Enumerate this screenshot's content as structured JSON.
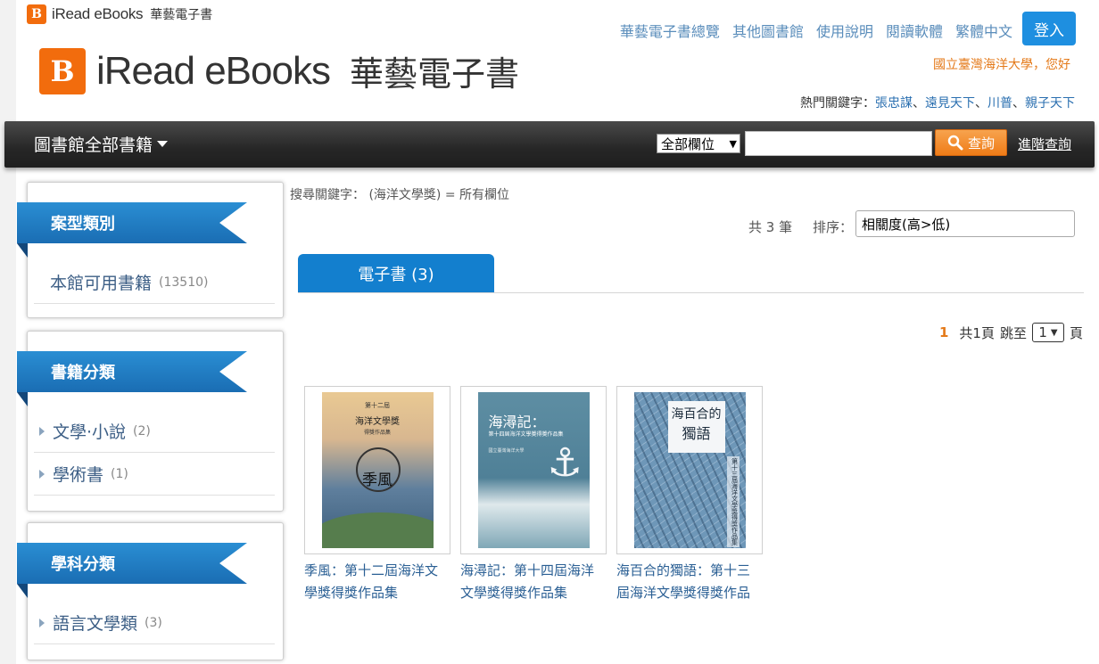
{
  "brand": {
    "name_en": "iRead eBooks",
    "name_zh": "華藝電子書",
    "logo_glyph": "B",
    "accent_color": "#f26c0d"
  },
  "top_links": [
    "華藝電子書總覽",
    "其他圖書館",
    "使用說明",
    "閱讀軟體",
    "繁體中文"
  ],
  "login_label": "登入",
  "greeting": "國立臺灣海洋大學，您好",
  "hot_keywords": {
    "label": "熱門關鍵字：",
    "items": [
      "張忠謀",
      "遠見天下",
      "川普",
      "親子天下"
    ],
    "separator": "、"
  },
  "navbar": {
    "menu_label": "圖書館全部書籍",
    "field_select": "全部欄位",
    "search_placeholder": "",
    "search_button": "查詢",
    "advanced_search": "進階查詢"
  },
  "sidebar": {
    "sections": [
      {
        "title": "案型類別",
        "items": [
          {
            "label": "本館可用書籍",
            "count": "(13510)"
          }
        ]
      },
      {
        "title": "書籍分類",
        "items": [
          {
            "label": "文學·小說",
            "count": "(2)"
          },
          {
            "label": "學術書",
            "count": "(1)"
          }
        ]
      },
      {
        "title": "學科分類",
        "items": [
          {
            "label": "語言文學類",
            "count": "(3)"
          }
        ]
      }
    ]
  },
  "search_summary": "搜尋關鍵字： (海洋文學獎) = 所有欄位",
  "result_count": "共 3 筆",
  "sort": {
    "label": "排序：",
    "value": "相關度(高>低)"
  },
  "tabs": [
    {
      "label": "電子書 (3)",
      "active": true
    }
  ],
  "pager": {
    "current": "1",
    "total_pages": "共1頁",
    "jump_label": "跳至",
    "jump_value": "1",
    "page_suffix": "頁"
  },
  "books": [
    {
      "title_line1": "季風：第十二屆海洋文",
      "title_line2": "學獎得獎作品集",
      "cover": {
        "top": "第十二屆",
        "title": "海洋文學獎",
        "sub": "得獎作品集",
        "big": "季風"
      }
    },
    {
      "title_line1": "海潯記：第十四屆海洋",
      "title_line2": "文學獎得獎作品集",
      "cover": {
        "title": "海潯記：",
        "sub": "第十四屆海洋文學獎得獎作品集",
        "author": "國立臺灣海洋大學"
      }
    },
    {
      "title_line1": "海百合的獨語：第十三",
      "title_line2": "屆海洋文學獎得獎作品",
      "cover": {
        "title_a": "海百合的",
        "title_b": "獨語",
        "vertical": "第十三屆海洋文學獎得獎作品集"
      }
    }
  ]
}
